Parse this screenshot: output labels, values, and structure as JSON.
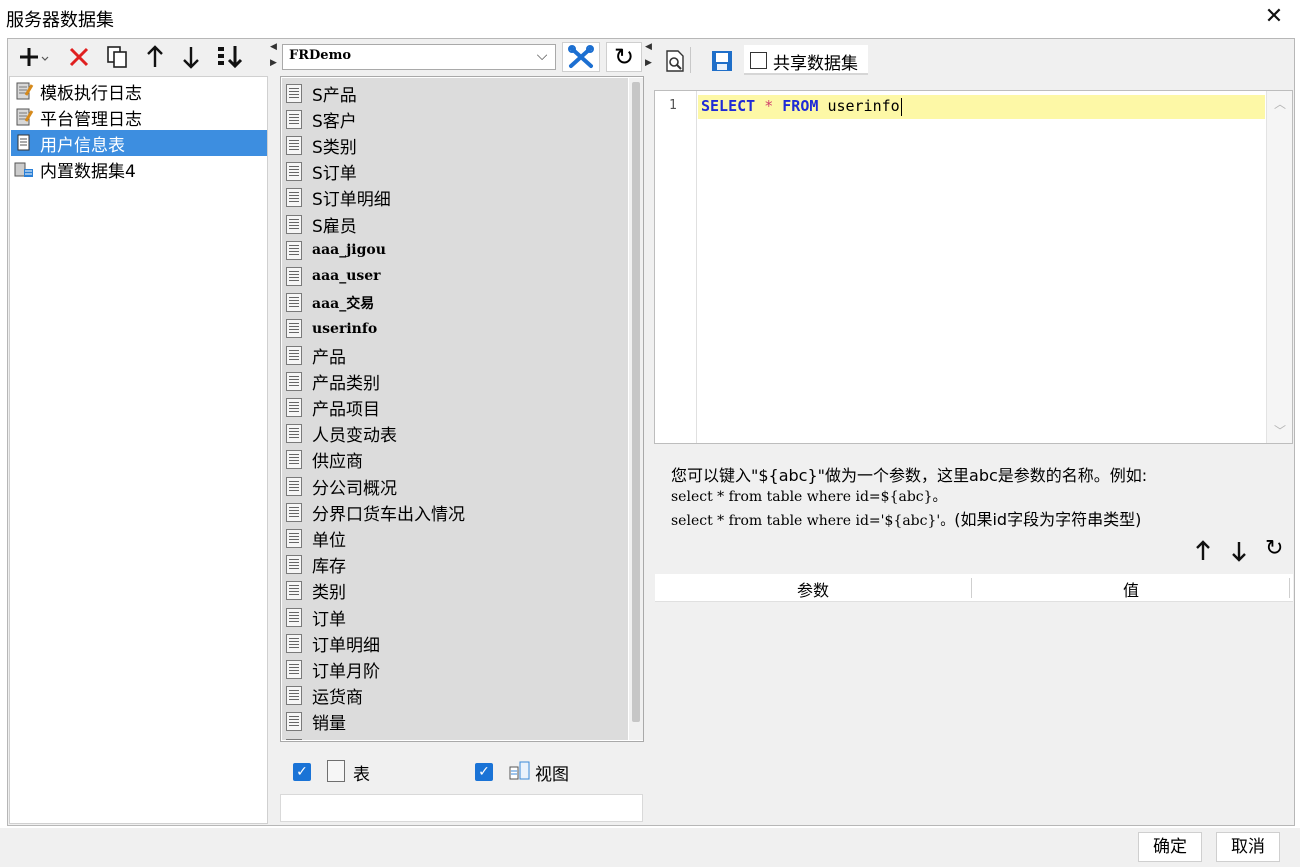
{
  "window": {
    "title": "服务器数据集",
    "close_label": "✕"
  },
  "left_toolbar": {
    "icons": [
      "add-icon",
      "delete-icon",
      "copy-icon",
      "move-up-icon",
      "move-down-icon",
      "sort-icon"
    ]
  },
  "datasets": [
    {
      "label": "模板执行日志",
      "icon": "db-table-icon",
      "selected": false
    },
    {
      "label": "平台管理日志",
      "icon": "db-table-icon",
      "selected": false
    },
    {
      "label": "用户信息表",
      "icon": "sql-dataset-icon",
      "selected": true
    },
    {
      "label": "内置数据集4",
      "icon": "builtin-dataset-icon",
      "selected": false
    }
  ],
  "connection": {
    "selected": "FRDemo"
  },
  "tables": [
    {
      "label": "S产品",
      "mono": false
    },
    {
      "label": "S客户",
      "mono": false
    },
    {
      "label": "S类别",
      "mono": false
    },
    {
      "label": "S订单",
      "mono": false
    },
    {
      "label": "S订单明细",
      "mono": false
    },
    {
      "label": "S雇员",
      "mono": false
    },
    {
      "label": "aaa_jigou",
      "mono": true
    },
    {
      "label": "aaa_user",
      "mono": true
    },
    {
      "label": "aaa_交易",
      "mono": true
    },
    {
      "label": "userinfo",
      "mono": true
    },
    {
      "label": "产品",
      "mono": false
    },
    {
      "label": "产品类别",
      "mono": false
    },
    {
      "label": "产品项目",
      "mono": false
    },
    {
      "label": "人员变动表",
      "mono": false
    },
    {
      "label": "供应商",
      "mono": false
    },
    {
      "label": "分公司概况",
      "mono": false
    },
    {
      "label": "分界口货车出入情况",
      "mono": false
    },
    {
      "label": "单位",
      "mono": false
    },
    {
      "label": "库存",
      "mono": false
    },
    {
      "label": "类别",
      "mono": false
    },
    {
      "label": "订单",
      "mono": false
    },
    {
      "label": "订单明细",
      "mono": false
    },
    {
      "label": "订单月阶",
      "mono": false
    },
    {
      "label": "运货商",
      "mono": false
    },
    {
      "label": "销量",
      "mono": false
    },
    {
      "label": "容量",
      "mono": false
    }
  ],
  "filters": {
    "table_label": "表",
    "table_checked": true,
    "view_label": "视图",
    "view_checked": true
  },
  "right_toolbar": {
    "share_label": "共享数据集",
    "share_checked": false
  },
  "editor": {
    "line_number": "1",
    "sql": {
      "kw1": "SELECT",
      "star": "*",
      "kw2": "FROM",
      "table": "userinfo"
    }
  },
  "hint": {
    "line1": "您可以键入\"${abc}\"做为一个参数，这里abc是参数的名称。例如:",
    "line2": "select * from table where id=${abc}。",
    "line3_code": "select * from table where id='${abc}'。",
    "line3_note": "(如果id字段为字符串类型)"
  },
  "params_table": {
    "col_param": "参数",
    "col_value": "值"
  },
  "footer": {
    "ok_label": "确定",
    "cancel_label": "取消"
  }
}
